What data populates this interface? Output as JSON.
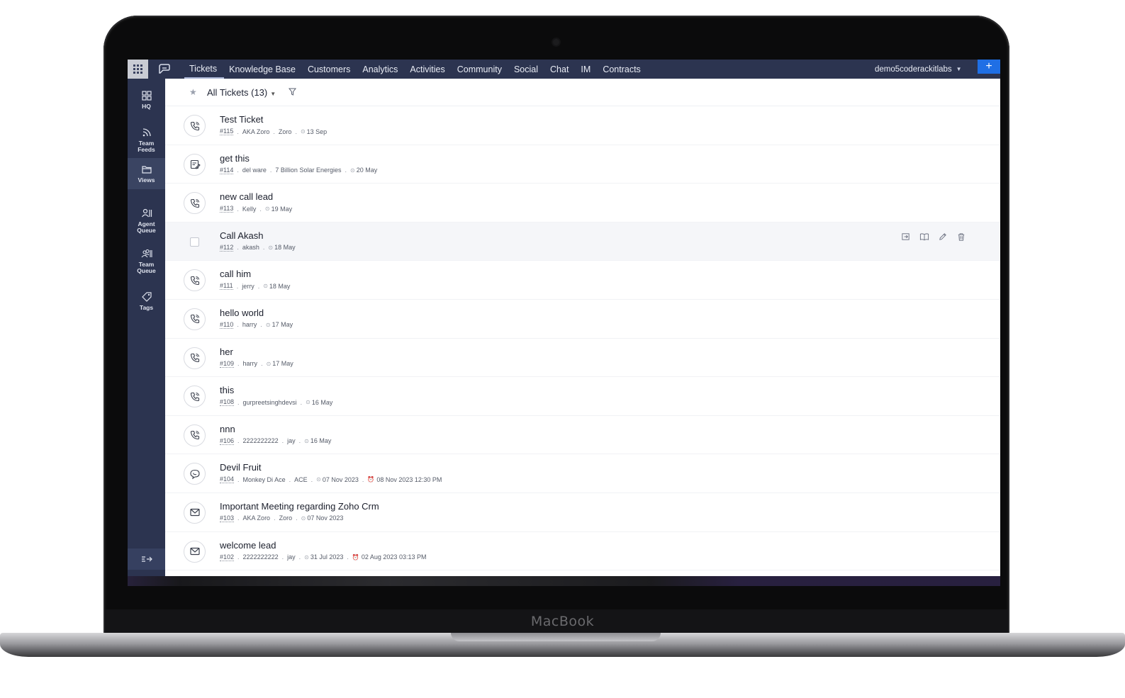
{
  "device": {
    "brand": "MacBook"
  },
  "topbar": {
    "nav": [
      "Tickets",
      "Knowledge Base",
      "Customers",
      "Analytics",
      "Activities",
      "Community",
      "Social",
      "Chat",
      "IM",
      "Contracts"
    ],
    "active_nav": "Tickets",
    "account": "demo5coderackitlabs",
    "plus_label": "+"
  },
  "sidebar": {
    "items": [
      {
        "label": "HQ",
        "icon": "grid-icon"
      },
      {
        "label": "Team\nFeeds",
        "icon": "feed-icon"
      },
      {
        "label": "Views",
        "icon": "folder-icon"
      },
      {
        "label": "Agent\nQueue",
        "icon": "agent-queue-icon"
      },
      {
        "label": "Team\nQueue",
        "icon": "team-queue-icon"
      },
      {
        "label": "Tags",
        "icon": "tag-icon"
      }
    ],
    "active": "Views"
  },
  "list": {
    "view_title": "All Tickets (13)",
    "row_actions": [
      "assign-icon",
      "read-icon",
      "edit-icon",
      "delete-icon"
    ],
    "tickets": [
      {
        "subject": "Test Ticket",
        "number": "#115",
        "contact": "AKA Zoro",
        "account": "Zoro",
        "date": "13 Sep",
        "channel": "phone",
        "due": ""
      },
      {
        "subject": "get this",
        "number": "#114",
        "contact": "del ware",
        "account": "7 Billion Solar Energies",
        "date": "20 May",
        "channel": "web",
        "due": ""
      },
      {
        "subject": "new call lead",
        "number": "#113",
        "contact": "Kelly",
        "account": "",
        "date": "19 May",
        "channel": "phone",
        "due": ""
      },
      {
        "subject": "Call Akash",
        "number": "#112",
        "contact": "akash",
        "account": "",
        "date": "18 May",
        "channel": "checkbox",
        "due": ""
      },
      {
        "subject": "call him",
        "number": "#111",
        "contact": "jerry",
        "account": "",
        "date": "18 May",
        "channel": "phone",
        "due": ""
      },
      {
        "subject": "hello world",
        "number": "#110",
        "contact": "harry",
        "account": "",
        "date": "17 May",
        "channel": "phone",
        "due": ""
      },
      {
        "subject": "her",
        "number": "#109",
        "contact": "harry",
        "account": "",
        "date": "17 May",
        "channel": "phone",
        "due": ""
      },
      {
        "subject": "this",
        "number": "#108",
        "contact": "gurpreetsinghdevsi",
        "account": "",
        "date": "16 May",
        "channel": "phone",
        "due": ""
      },
      {
        "subject": "nnn",
        "number": "#106",
        "contact": "2222222222",
        "account": "jay",
        "date": "16 May",
        "channel": "phone",
        "due": ""
      },
      {
        "subject": "Devil Fruit",
        "number": "#104",
        "contact": "Monkey Di Ace",
        "account": "ACE",
        "date": "07 Nov 2023",
        "channel": "chat",
        "due": "08 Nov 2023 12:30 PM"
      },
      {
        "subject": "Important Meeting regarding Zoho Crm",
        "number": "#103",
        "contact": "AKA Zoro",
        "account": "Zoro",
        "date": "07 Nov 2023",
        "channel": "email",
        "due": ""
      },
      {
        "subject": "welcome lead",
        "number": "#102",
        "contact": "2222222222",
        "account": "jay",
        "date": "31 Jul 2023",
        "channel": "email",
        "due": "02 Aug 2023 03:13 PM"
      }
    ]
  }
}
